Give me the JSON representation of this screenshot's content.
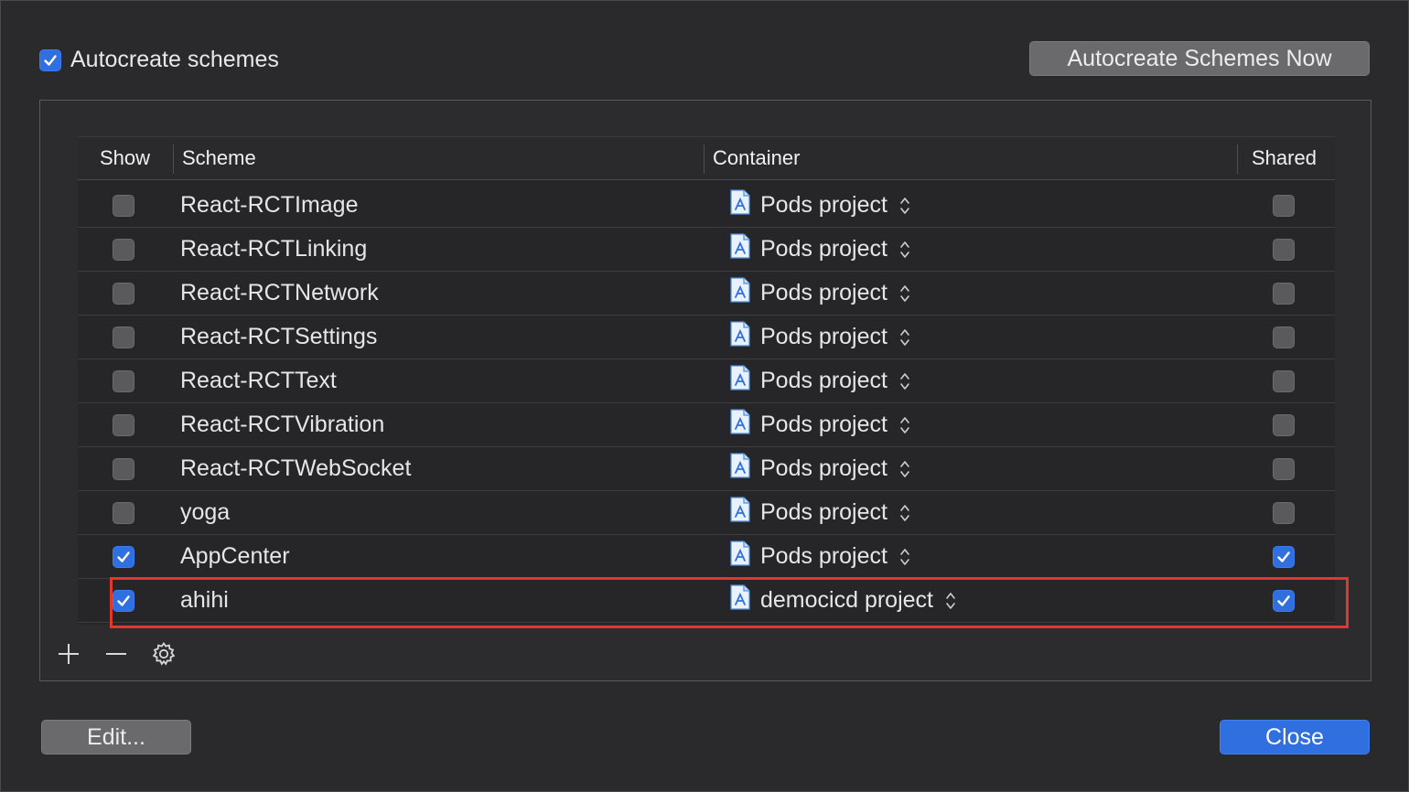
{
  "autocreate": {
    "checkbox_label": "Autocreate schemes",
    "checked": true,
    "button_label": "Autocreate Schemes Now"
  },
  "table": {
    "columns": {
      "show": "Show",
      "scheme": "Scheme",
      "container": "Container",
      "shared": "Shared"
    },
    "rows": [
      {
        "show": false,
        "scheme": "React-RCTImage",
        "container": "Pods project",
        "shared": false
      },
      {
        "show": false,
        "scheme": "React-RCTLinking",
        "container": "Pods project",
        "shared": false
      },
      {
        "show": false,
        "scheme": "React-RCTNetwork",
        "container": "Pods project",
        "shared": false
      },
      {
        "show": false,
        "scheme": "React-RCTSettings",
        "container": "Pods project",
        "shared": false
      },
      {
        "show": false,
        "scheme": "React-RCTText",
        "container": "Pods project",
        "shared": false
      },
      {
        "show": false,
        "scheme": "React-RCTVibration",
        "container": "Pods project",
        "shared": false
      },
      {
        "show": false,
        "scheme": "React-RCTWebSocket",
        "container": "Pods project",
        "shared": false
      },
      {
        "show": false,
        "scheme": "yoga",
        "container": "Pods project",
        "shared": false
      },
      {
        "show": true,
        "scheme": "AppCenter",
        "container": "Pods project",
        "shared": true
      },
      {
        "show": true,
        "scheme": "ahihi",
        "container": "democicd project",
        "shared": true
      }
    ]
  },
  "toolbar": {
    "add_icon": "plus-icon",
    "remove_icon": "minus-icon",
    "settings_icon": "gear-icon"
  },
  "footer": {
    "edit_label": "Edit...",
    "close_label": "Close"
  },
  "colors": {
    "accent": "#2f6fe0",
    "highlight": "#e0392b",
    "background": "#2a2a2c"
  }
}
